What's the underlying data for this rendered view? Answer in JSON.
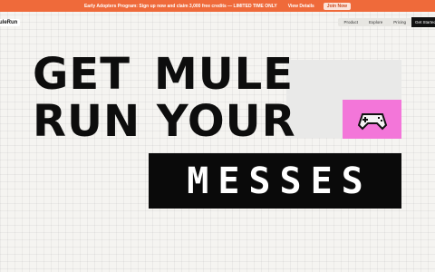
{
  "promo": {
    "message": "Early Adopters Program: Sign up now and claim 3,000 free credits — LIMITED TIME ONLY",
    "details_label": "View Details",
    "join_label": "Join Now",
    "background_color": "#ef6a3a"
  },
  "header": {
    "logo_text": "uleRun",
    "nav": [
      "Product",
      "Explore",
      "Pricing"
    ],
    "cta_label": "Get Started"
  },
  "hero": {
    "line1_a": "GET",
    "line1_b": "MULE",
    "line2": "RUN YOUR",
    "highlight": "MESSES",
    "accent_pink": "#f376d9",
    "icon": "gamepad-icon"
  }
}
